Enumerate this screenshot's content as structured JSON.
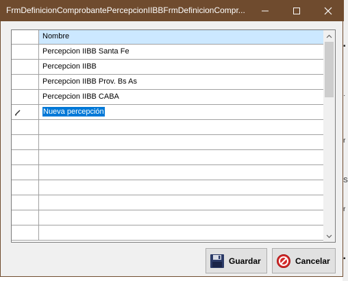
{
  "window": {
    "title": "FrmDefinicionComprobantePercepcionIIBBFrmDefinicionCompr...",
    "minimize_icon": "minimize-icon",
    "maximize_icon": "maximize-icon",
    "close_icon": "close-icon"
  },
  "grid": {
    "column_header": "Nombre",
    "rows": [
      {
        "nombre": "Percepcion IIBB Santa Fe"
      },
      {
        "nombre": "Percepcion IIBB"
      },
      {
        "nombre": "Percepcion IIBB Prov. Bs As"
      },
      {
        "nombre": "Percepcion IIBB CABA"
      },
      {
        "nombre": "Nueva percepción",
        "editing": true
      }
    ],
    "edit_icon": "pencil-icon"
  },
  "buttons": {
    "save_label": "Guardar",
    "save_icon": "floppy-disk-icon",
    "cancel_label": "Cancelar",
    "cancel_icon": "cancel-icon"
  },
  "colors": {
    "titlebar": "#6f4b2e",
    "header_highlight": "#cce8ff",
    "selection": "#0078d7"
  }
}
